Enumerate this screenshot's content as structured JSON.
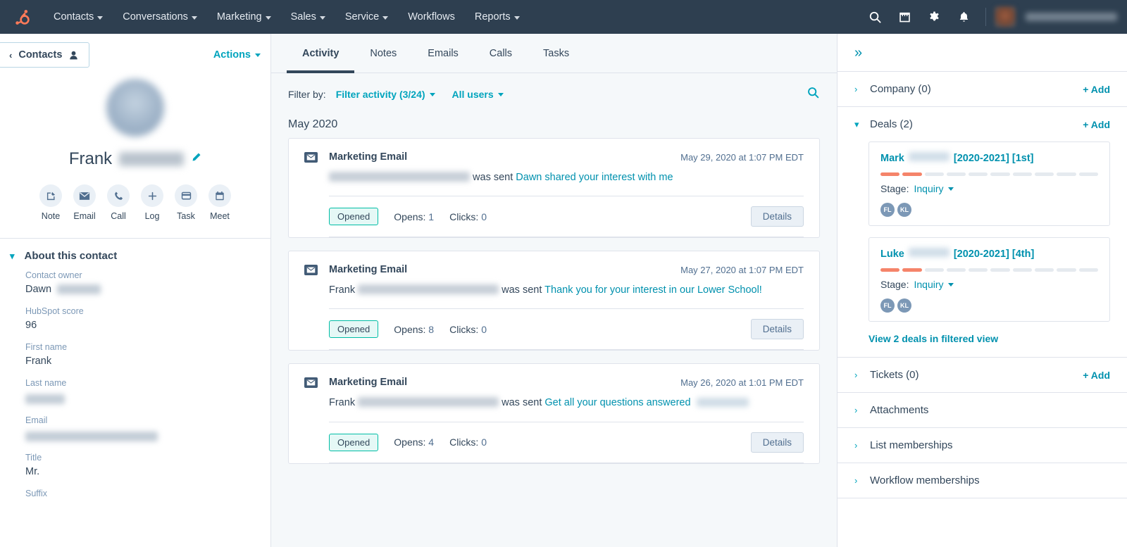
{
  "topnav": {
    "logo_name": "hubspot-sprocket-logo",
    "brand_color": "#ff7a59",
    "bar_color": "#2e3f50",
    "items": [
      {
        "label": "Contacts",
        "has_caret": true
      },
      {
        "label": "Conversations",
        "has_caret": true
      },
      {
        "label": "Marketing",
        "has_caret": true
      },
      {
        "label": "Sales",
        "has_caret": true
      },
      {
        "label": "Service",
        "has_caret": true
      },
      {
        "label": "Workflows",
        "has_caret": false
      },
      {
        "label": "Reports",
        "has_caret": true
      }
    ],
    "icons": [
      "search-icon",
      "marketplace-icon",
      "settings-gear-icon",
      "notifications-bell-icon"
    ]
  },
  "left_panel": {
    "back_label": "Contacts",
    "actions_label": "Actions",
    "contact_first_name": "Frank",
    "quick_actions": [
      {
        "label": "Note",
        "icon": "note-icon"
      },
      {
        "label": "Email",
        "icon": "email-icon"
      },
      {
        "label": "Call",
        "icon": "call-icon"
      },
      {
        "label": "Log",
        "icon": "log-plus-icon"
      },
      {
        "label": "Task",
        "icon": "task-icon"
      },
      {
        "label": "Meet",
        "icon": "meet-calendar-icon"
      }
    ],
    "about_title": "About this contact",
    "fields": [
      {
        "label": "Contact owner",
        "value": "Dawn",
        "blurred": true,
        "blur_width": 62
      },
      {
        "label": "HubSpot score",
        "value": "96",
        "blurred": false
      },
      {
        "label": "First name",
        "value": "Frank",
        "blurred": false
      },
      {
        "label": "Last name",
        "value": "",
        "blurred": true,
        "blur_width": 56
      },
      {
        "label": "Email",
        "value": "",
        "blurred": true,
        "blur_width": 188
      },
      {
        "label": "Title",
        "value": "Mr.",
        "blurred": false
      },
      {
        "label": "Suffix",
        "value": "",
        "blurred": false
      }
    ]
  },
  "center": {
    "tabs": [
      {
        "label": "Activity",
        "active": true
      },
      {
        "label": "Notes",
        "active": false
      },
      {
        "label": "Emails",
        "active": false
      },
      {
        "label": "Calls",
        "active": false
      },
      {
        "label": "Tasks",
        "active": false
      }
    ],
    "filter_by_label": "Filter by:",
    "filter_activity_label": "Filter activity (3/24)",
    "all_users_label": "All users",
    "search_icon": "search-icon",
    "month_header": "May 2020",
    "activities": [
      {
        "type": "Marketing Email",
        "date": "May 29, 2020 at 1:07 PM EDT",
        "prefix": "",
        "recipient_blur_width": 200,
        "sent_text": "was sent",
        "subject": "Dawn shared your interest with me",
        "trailing_blur": false,
        "status": "Opened",
        "opens_label": "Opens:",
        "opens": "1",
        "clicks_label": "Clicks:",
        "clicks": "0",
        "details_label": "Details"
      },
      {
        "type": "Marketing Email",
        "date": "May 27, 2020 at 1:07 PM EDT",
        "prefix": "Frank",
        "recipient_blur_width": 200,
        "sent_text": "was sent",
        "subject": "Thank you for your interest in our Lower School!",
        "trailing_blur": false,
        "status": "Opened",
        "opens_label": "Opens:",
        "opens": "8",
        "clicks_label": "Clicks:",
        "clicks": "0",
        "details_label": "Details"
      },
      {
        "type": "Marketing Email",
        "date": "May 26, 2020 at 1:01 PM EDT",
        "prefix": "Frank",
        "recipient_blur_width": 200,
        "sent_text": "was sent",
        "subject": "Get all your questions answered",
        "trailing_blur": true,
        "status": "Opened",
        "opens_label": "Opens:",
        "opens": "4",
        "clicks_label": "Clicks:",
        "clicks": "0",
        "details_label": "Details"
      }
    ]
  },
  "right_panel": {
    "collapse_icon": "chevron-double-right-icon",
    "company": {
      "title": "Company (0)",
      "add_label": "+ Add",
      "expanded": false
    },
    "deals": {
      "title": "Deals (2)",
      "add_label": "+ Add",
      "expanded": true,
      "stage_label": "Stage:",
      "pipeline_total": 10,
      "pipeline_filled": 2,
      "pipeline_fill_color": "#f5846a",
      "view_link": "View 2 deals in filtered view",
      "cards": [
        {
          "owner_first": "Mark",
          "suffix": "[2020-2021] [1st]",
          "stage": "Inquiry",
          "avatars": [
            "FL",
            "KL"
          ]
        },
        {
          "owner_first": "Luke",
          "suffix": "[2020-2021] [4th]",
          "stage": "Inquiry",
          "avatars": [
            "FL",
            "KL"
          ]
        }
      ]
    },
    "tickets": {
      "title": "Tickets (0)",
      "add_label": "+ Add"
    },
    "attachments": {
      "title": "Attachments"
    },
    "list_memberships": {
      "title": "List memberships"
    },
    "workflow_memberships": {
      "title": "Workflow memberships"
    }
  }
}
